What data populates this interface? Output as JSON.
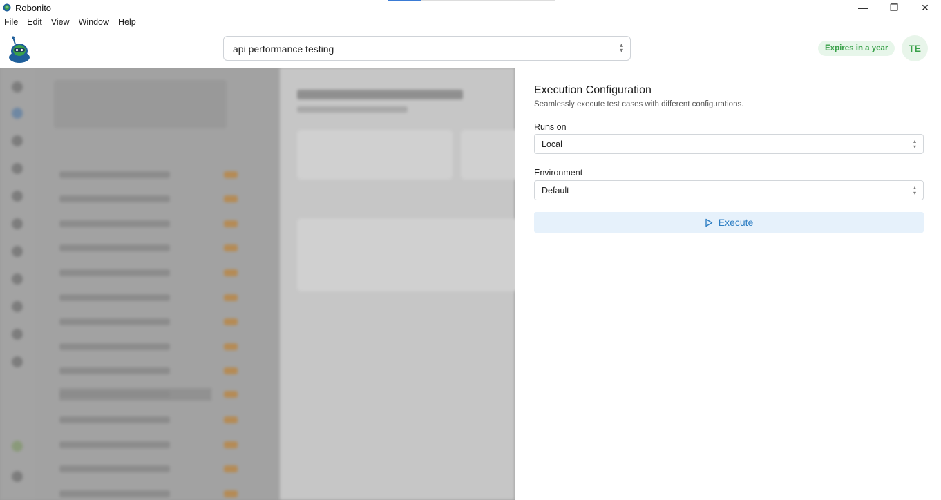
{
  "window": {
    "title": "Robonito",
    "controls": {
      "minimize": "—",
      "restore": "❐",
      "close": "✕"
    }
  },
  "menu": [
    "File",
    "Edit",
    "View",
    "Window",
    "Help"
  ],
  "header": {
    "search_value": "api performance testing",
    "license_badge": "Expires in a year",
    "avatar_initials": "TE"
  },
  "drawer": {
    "title": "Execution Configuration",
    "subtitle": "Seamlessly execute test cases with different configurations.",
    "runs_on_label": "Runs on",
    "runs_on_value": "Local",
    "environment_label": "Environment",
    "environment_value": "Default",
    "execute_label": "Execute"
  },
  "colors": {
    "accent": "#2f7fc4",
    "badge_green": "#3aa14a",
    "execute_bg": "#e6f1fb",
    "backdrop": "#9b9b9b"
  }
}
